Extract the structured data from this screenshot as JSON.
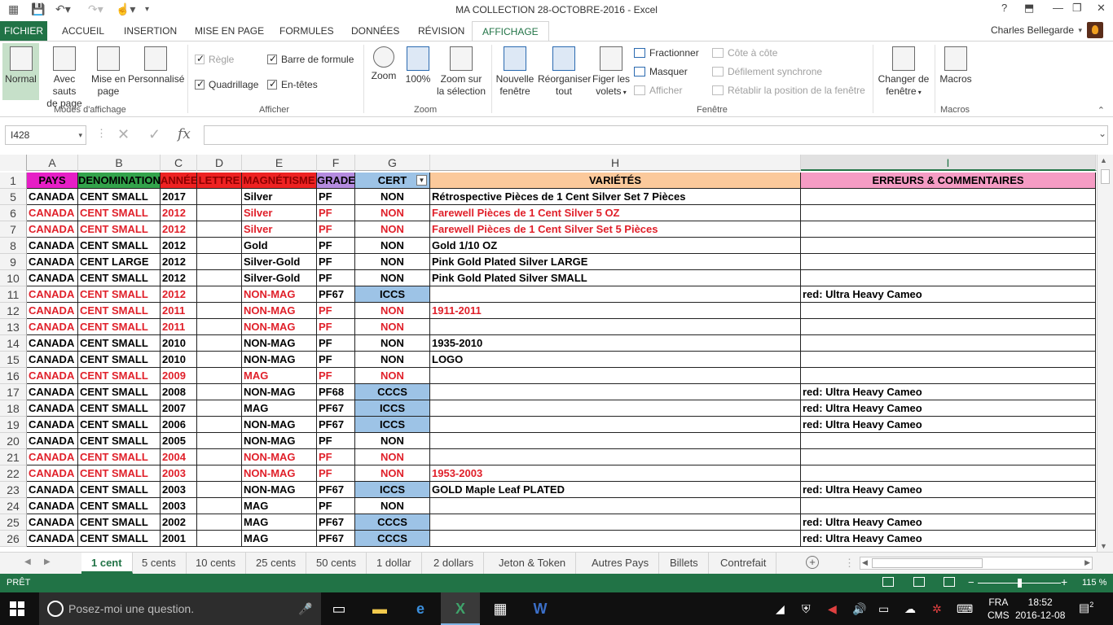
{
  "window": {
    "title": "MA COLLECTION 28-OCTOBRE-2016 - Excel",
    "help": "?",
    "minimize": "—",
    "maximize": "❐",
    "close": "✕"
  },
  "ribbon_tabs": [
    "FICHIER",
    "ACCUEIL",
    "INSERTION",
    "MISE EN PAGE",
    "FORMULES",
    "DONNÉES",
    "RÉVISION",
    "AFFICHAGE"
  ],
  "user": {
    "name": "Charles Bellegarde"
  },
  "ribbon": {
    "modes": {
      "normal": "Normal",
      "sauts_1": "Avec sauts",
      "sauts_2": "de page",
      "mep_1": "Mise en",
      "mep_2": "page",
      "perso": "Personnalisé",
      "group": "Modes d'affichage"
    },
    "afficher": {
      "regle": "Règle",
      "quadrillage": "Quadrillage",
      "barre_formule": "Barre de formule",
      "entetes": "En-têtes",
      "group": "Afficher"
    },
    "zoom": {
      "zoom": "Zoom",
      "cent": "100%",
      "sel_1": "Zoom sur",
      "sel_2": "la sélection",
      "group": "Zoom"
    },
    "fenetre": {
      "nouvelle_1": "Nouvelle",
      "nouvelle_2": "fenêtre",
      "reorg_1": "Réorganiser",
      "reorg_2": "tout",
      "figer_1": "Figer les",
      "figer_2": "volets",
      "fractionner": "Fractionner",
      "masquer": "Masquer",
      "afficher": "Afficher",
      "cote": "Côte à côte",
      "defilement": "Défilement synchrone",
      "retablir": "Rétablir la position de la fenêtre",
      "changer_1": "Changer de",
      "changer_2": "fenêtre",
      "group": "Fenêtre"
    },
    "macros": {
      "label": "Macros",
      "group": "Macros"
    }
  },
  "formula_bar": {
    "name_box": "I428",
    "fx": "fx",
    "content": ""
  },
  "columns": [
    "A",
    "B",
    "C",
    "D",
    "E",
    "F",
    "G",
    "H",
    "I"
  ],
  "header_row": {
    "num": "1",
    "cells": [
      "PAYS",
      "DENOMINATION",
      "ANNÉE",
      "LETTRE",
      "MAGNÉTISME",
      "GRADE",
      "CERT",
      "VARIÉTÉS",
      "ERREURS & COMMENTAIRES"
    ]
  },
  "rows": [
    {
      "num": "5",
      "red": false,
      "cells": [
        "CANADA",
        "CENT SMALL",
        "2017",
        "",
        "Silver",
        "PF",
        "NON",
        "Rétrospective Pièces de 1 Cent  Silver Set 7 Pièces",
        ""
      ]
    },
    {
      "num": "6",
      "red": true,
      "cells": [
        "CANADA",
        "CENT SMALL",
        "2012",
        "",
        "Silver",
        "PF",
        "NON",
        "Farewell Pièces de 1 Cent  Silver 5 OZ",
        ""
      ]
    },
    {
      "num": "7",
      "red": true,
      "cells": [
        "CANADA",
        "CENT SMALL",
        "2012",
        "",
        "Silver",
        "PF",
        "NON",
        "Farewell Pièces de 1 Cent  Silver Set 5 Pièces",
        ""
      ]
    },
    {
      "num": "8",
      "red": false,
      "cells": [
        "CANADA",
        "CENT SMALL",
        "2012",
        "",
        "Gold",
        "PF",
        "NON",
        "Gold 1/10 OZ",
        ""
      ]
    },
    {
      "num": "9",
      "red": false,
      "cells": [
        "CANADA",
        "CENT LARGE",
        "2012",
        "",
        "Silver-Gold",
        "PF",
        "NON",
        "Pink Gold Plated Silver LARGE",
        ""
      ]
    },
    {
      "num": "10",
      "red": false,
      "cells": [
        "CANADA",
        "CENT SMALL",
        "2012",
        "",
        "Silver-Gold",
        "PF",
        "NON",
        "Pink Gold Plated Silver SMALL",
        ""
      ]
    },
    {
      "num": "11",
      "red": false,
      "cells": [
        "CANADA",
        "CENT SMALL",
        "2012",
        "",
        "NON-MAG",
        "PF67",
        "ICCS",
        "",
        "red: Ultra Heavy Cameo"
      ],
      "partial_red": true
    },
    {
      "num": "12",
      "red": true,
      "cells": [
        "CANADA",
        "CENT SMALL",
        "2011",
        "",
        "NON-MAG",
        "PF",
        "NON",
        "1911-2011",
        ""
      ]
    },
    {
      "num": "13",
      "red": true,
      "cells": [
        "CANADA",
        "CENT SMALL",
        "2011",
        "",
        "NON-MAG",
        "PF",
        "NON",
        "",
        ""
      ]
    },
    {
      "num": "14",
      "red": false,
      "cells": [
        "CANADA",
        "CENT SMALL",
        "2010",
        "",
        "NON-MAG",
        "PF",
        "NON",
        "1935-2010",
        ""
      ]
    },
    {
      "num": "15",
      "red": false,
      "cells": [
        "CANADA",
        "CENT SMALL",
        "2010",
        "",
        "NON-MAG",
        "PF",
        "NON",
        "LOGO",
        ""
      ]
    },
    {
      "num": "16",
      "red": true,
      "cells": [
        "CANADA",
        "CENT SMALL",
        "2009",
        "",
        "MAG",
        "PF",
        "NON",
        "",
        ""
      ]
    },
    {
      "num": "17",
      "red": false,
      "cells": [
        "CANADA",
        "CENT SMALL",
        "2008",
        "",
        "NON-MAG",
        "PF68",
        "CCCS",
        "",
        "red: Ultra Heavy Cameo"
      ]
    },
    {
      "num": "18",
      "red": false,
      "cells": [
        "CANADA",
        "CENT SMALL",
        "2007",
        "",
        "MAG",
        "PF67",
        "ICCS",
        "",
        "red: Ultra Heavy Cameo"
      ]
    },
    {
      "num": "19",
      "red": false,
      "cells": [
        "CANADA",
        "CENT SMALL",
        "2006",
        "",
        "NON-MAG",
        "PF67",
        "ICCS",
        "",
        "red: Ultra Heavy Cameo"
      ]
    },
    {
      "num": "20",
      "red": false,
      "cells": [
        "CANADA",
        "CENT SMALL",
        "2005",
        "",
        "NON-MAG",
        "PF",
        "NON",
        "",
        ""
      ]
    },
    {
      "num": "21",
      "red": true,
      "cells": [
        "CANADA",
        "CENT SMALL",
        "2004",
        "",
        "NON-MAG",
        "PF",
        "NON",
        "",
        ""
      ]
    },
    {
      "num": "22",
      "red": true,
      "cells": [
        "CANADA",
        "CENT SMALL",
        "2003",
        "",
        "NON-MAG",
        "PF",
        "NON",
        "1953-2003",
        ""
      ]
    },
    {
      "num": "23",
      "red": false,
      "cells": [
        "CANADA",
        "CENT SMALL",
        "2003",
        "",
        "NON-MAG",
        "PF67",
        "ICCS",
        "GOLD Maple Leaf PLATED",
        "red: Ultra Heavy Cameo"
      ]
    },
    {
      "num": "24",
      "red": false,
      "cells": [
        "CANADA",
        "CENT SMALL",
        "2003",
        "",
        "MAG",
        "PF",
        "NON",
        "",
        ""
      ]
    },
    {
      "num": "25",
      "red": false,
      "cells": [
        "CANADA",
        "CENT SMALL",
        "2002",
        "",
        "MAG",
        "PF67",
        "CCCS",
        "",
        "red: Ultra Heavy Cameo"
      ]
    },
    {
      "num": "26",
      "red": false,
      "cells": [
        "CANADA",
        "CENT SMALL",
        "2001",
        "",
        "MAG",
        "PF67",
        "CCCS",
        "",
        "red: Ultra Heavy Cameo"
      ]
    }
  ],
  "sheet_tabs": [
    "1 cent",
    "5 cents",
    "10 cents",
    "25 cents",
    "50 cents",
    "1 dollar",
    "2 dollars",
    "Jeton & Token",
    "Autres Pays",
    "Billets",
    "Contrefait"
  ],
  "active_sheet": "1 cent",
  "status": {
    "text": "PRÊT",
    "zoom": "115 %",
    "zoom_level_percent": 115
  },
  "taskbar": {
    "search_placeholder": "Posez-moi une question.",
    "lang_1": "FRA",
    "lang_2": "CMS",
    "time": "18:52",
    "date": "2016-12-08",
    "notifications": "2"
  },
  "colors": {
    "excel_green": "#217346",
    "cert_blue": "#9dc3e6",
    "red_text": "#e0202a"
  }
}
